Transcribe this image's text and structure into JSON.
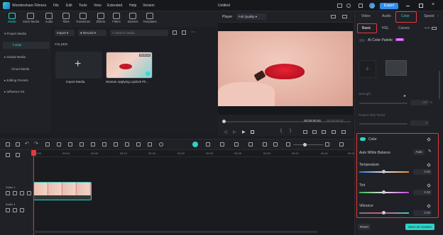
{
  "app": {
    "name": "Wondershare Filmora",
    "doc_title": "Untitled",
    "export_label": "Export"
  },
  "menu": [
    "File",
    "Edit",
    "Tools",
    "View",
    "Extended",
    "Help",
    "Version"
  ],
  "toolbar": [
    "Media",
    "Stock Media",
    "Audio",
    "Titles",
    "Transitions",
    "Effects",
    "Filters",
    "Stickers",
    "Templates"
  ],
  "sidebar": [
    "Project Media",
    "Folder",
    "Global Media",
    "Cloud Media",
    "Editing Presets",
    "Influence Kit"
  ],
  "media": {
    "import_label": "Import",
    "record_label": "Record",
    "search_placeholder": "Search media",
    "folder_heading": "FOLDER",
    "import_card_label": "Import Media",
    "clip_name": "Woman Applying Lipstick Pil...",
    "clip_duration": "00:00:09"
  },
  "player": {
    "label": "Player",
    "quality": "Full Quality",
    "time_current": "00:00:00:00",
    "time_total": "00:00:09:22"
  },
  "right": {
    "tabs": [
      "Video",
      "Audio",
      "Color",
      "Speed"
    ],
    "subtabs": [
      "Basic",
      "HSL",
      "Curves"
    ],
    "ai_palette": "AI Color Palette",
    "new_badge": "NEW",
    "strength_label": "Strength",
    "strength_value": "100",
    "protect_label": "Protect Skin Tones",
    "protect_value": "0",
    "color_section": "Color",
    "awb_label": "Auto White Balance",
    "auto_btn": "Auto",
    "temperature_label": "Temperature",
    "temperature_value": "0.00",
    "tint_label": "Tint",
    "tint_value": "0.00",
    "vibrance_label": "Vibrance",
    "vibrance_value": "0.00",
    "reset_label": "Reset",
    "save_label": "Save as Custom"
  },
  "timeline": {
    "ruler": [
      "00:00",
      "00:04",
      "00:08",
      "00:12",
      "00:16",
      "00:20",
      "00:25",
      "00:29",
      "00:33",
      "00:37",
      "00:41",
      "00:45",
      "00:49"
    ],
    "video_track": "Video 1",
    "audio_track": "Audio 1"
  }
}
